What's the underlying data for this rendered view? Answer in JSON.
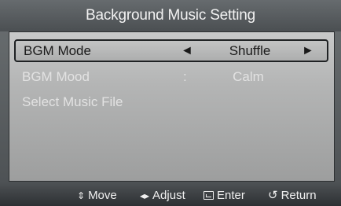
{
  "header": {
    "title": "Background Music Setting"
  },
  "menu": {
    "rows": [
      {
        "label": "BGM Mode",
        "arrow_left": "◄",
        "value": "Shuffle",
        "arrow_right": "►",
        "state": "selected"
      },
      {
        "label": "BGM Mood",
        "separator": ":",
        "value": "Calm",
        "state": "disabled"
      },
      {
        "label": "Select Music File",
        "state": "disabled"
      }
    ]
  },
  "help_bar": {
    "move": {
      "icon": "up-down-arrows-icon",
      "glyph": "⇕",
      "label": "Move"
    },
    "adjust": {
      "icon": "left-right-arrows-icon",
      "glyph": "◂▸",
      "label": "Adjust"
    },
    "enter": {
      "icon": "enter-icon",
      "label": "Enter"
    },
    "return": {
      "icon": "return-icon",
      "glyph": "↺",
      "label": "Return"
    }
  },
  "colors": {
    "title_bar": "#5a5e61",
    "menu_panel": "#b4b5b5",
    "selected_text": "#1a1a1a",
    "disabled_text": "#e2e2e2",
    "help_bar": "#3a3d40"
  }
}
